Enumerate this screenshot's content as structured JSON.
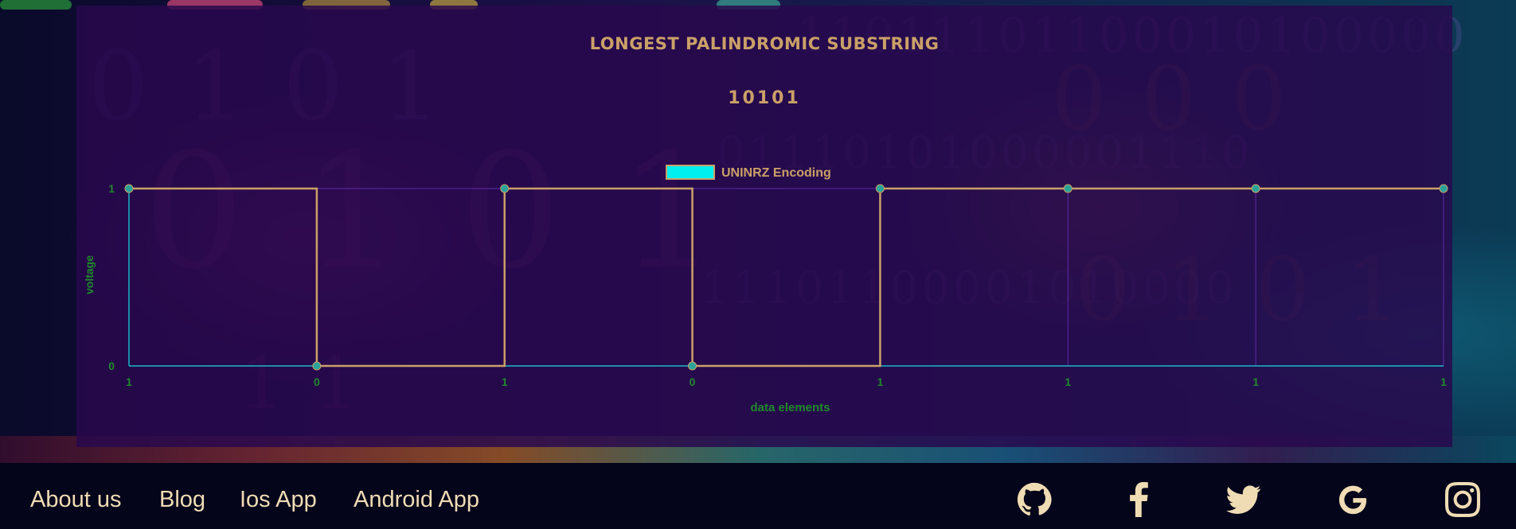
{
  "page": {
    "title": "LONGEST PALINDROMIC SUBSTRING",
    "result": "10101"
  },
  "chart_data": {
    "type": "line",
    "step": true,
    "legend": {
      "label": "UNINRZ Encoding",
      "position": "top-center",
      "swatch_color": "#00f0f0"
    },
    "xlabel": "data elements",
    "ylabel": "voltage",
    "categories": [
      "1",
      "0",
      "1",
      "0",
      "1",
      "1",
      "1",
      "1"
    ],
    "series": [
      {
        "name": "UNINRZ Encoding",
        "values": [
          1,
          0,
          1,
          0,
          1,
          1,
          1,
          1
        ]
      }
    ],
    "ylim": [
      0,
      1
    ],
    "yticks": [
      "0",
      "1"
    ],
    "grid": true,
    "colors": {
      "line": "#cba068",
      "point": "#2aa39a",
      "axis": "#19b8c8",
      "grid": "#5a2aa8",
      "labels": "#1f8a2a"
    }
  },
  "footer": {
    "links": [
      "About us",
      "Blog",
      "Ios App",
      "Android App"
    ],
    "social": [
      "github-icon",
      "facebook-icon",
      "twitter-icon",
      "google-icon",
      "instagram-icon"
    ]
  }
}
